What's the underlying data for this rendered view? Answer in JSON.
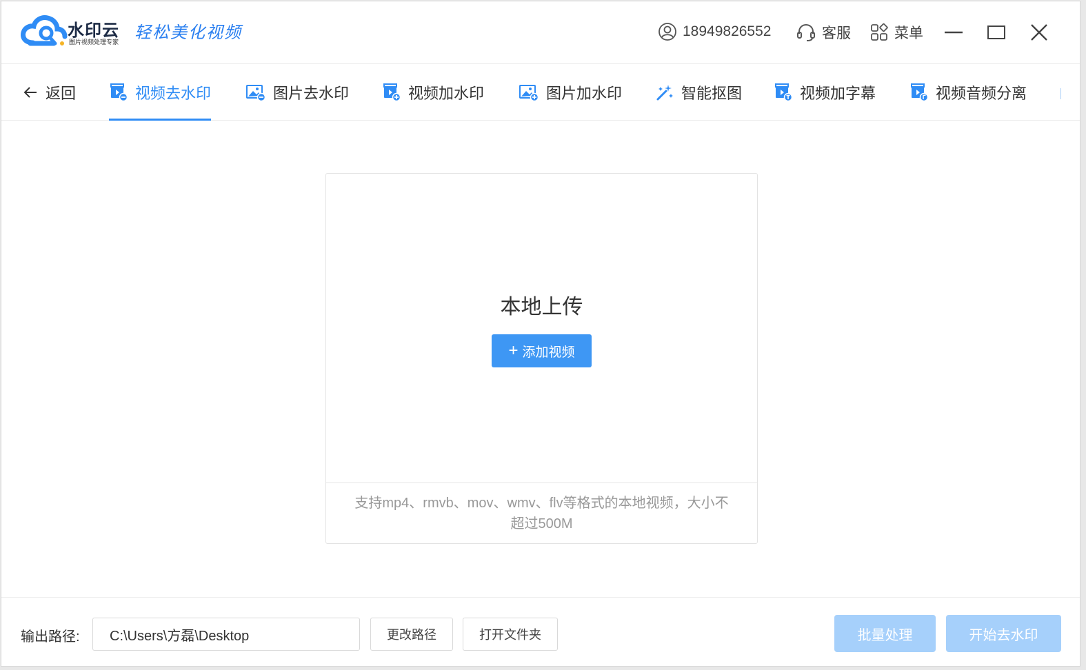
{
  "app": {
    "brand": "水印云",
    "brand_sub": "图片视频处理专家",
    "slogan": "轻松美化视频"
  },
  "header": {
    "phone": "18949826552",
    "service_label": "客服",
    "menu_label": "菜单"
  },
  "nav": {
    "back_label": "返回",
    "items": [
      {
        "label": "视频去水印",
        "icon": "video-remove-icon",
        "active": true
      },
      {
        "label": "图片去水印",
        "icon": "image-remove-icon",
        "active": false
      },
      {
        "label": "视频加水印",
        "icon": "video-add-icon",
        "active": false
      },
      {
        "label": "图片加水印",
        "icon": "image-add-icon",
        "active": false
      },
      {
        "label": "智能抠图",
        "icon": "magic-wand-icon",
        "active": false
      },
      {
        "label": "视频加字幕",
        "icon": "video-subtitle-icon",
        "active": false
      },
      {
        "label": "视频音频分离",
        "icon": "video-audio-icon",
        "active": false
      }
    ]
  },
  "upload": {
    "title": "本地上传",
    "add_button": "添加视频",
    "hint": "支持mp4、rmvb、mov、wmv、flv等格式的本地视频，大小不超过500M"
  },
  "output": {
    "label": "输出路径:",
    "path": "C:\\Users\\方磊\\Desktop",
    "change_button": "更改路径",
    "open_button": "打开文件夹",
    "batch_button": "批量处理",
    "start_button": "开始去水印"
  },
  "colors": {
    "accent": "#2f8cf5",
    "button_blue": "#3e97f4",
    "button_disabled": "#a6d0fb"
  }
}
